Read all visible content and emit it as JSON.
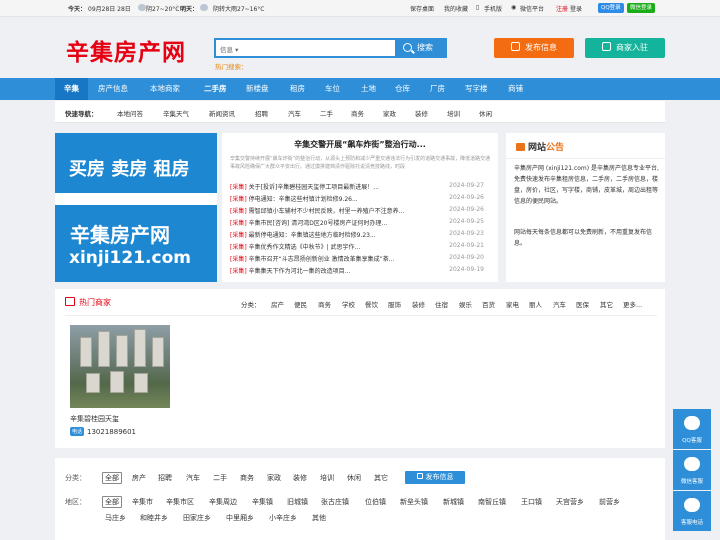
{
  "topbar": {
    "today_label": "今天：",
    "today_text": "09月28日 28日",
    "today_weather": "阴27~20°C",
    "tomorrow_label": "明天：",
    "tomorrow_weather": "阴转大雨27~16°C",
    "links": [
      "保存桌面",
      "我的收藏",
      "手机版",
      "微信平台"
    ],
    "register": "注册",
    "sep": "|",
    "login": "登录",
    "qq_login": "QQ登录",
    "wechat_login": "微信登录",
    "qq_color": "#2d8ce6",
    "wechat_color": "#1aad19"
  },
  "header": {
    "logo": "辛集房产网",
    "search_select": "信息",
    "search_button": "搜索",
    "hot_search": "热门搜索：",
    "publish_button": "发布信息",
    "join_button": "商家入驻",
    "publish_color": "#f46c12",
    "join_color": "#14b39b"
  },
  "nav": {
    "items": [
      "辛集",
      "房产信息",
      "本地商家",
      "二手房",
      "新楼盘",
      "租房",
      "车位",
      "土地",
      "仓库",
      "厂房",
      "写字楼",
      "商铺"
    ]
  },
  "quicknav": {
    "label": "快速导航：",
    "items": [
      "本地问答",
      "辛集天气",
      "新闻资讯",
      "招聘",
      "汽车",
      "二手",
      "商务",
      "家政",
      "装修",
      "培训",
      "休闲"
    ]
  },
  "banner": {
    "line1": "买房 卖房 租房",
    "line2": "辛集房产网",
    "line3": "xinji121.com"
  },
  "news": {
    "headline": "辛集交警开展“飙车炸街”整治行动...",
    "summary": "辛集交警持续开展“飙车炸街”的整治行动，从源头上预防和减少严重交通违法行为引发的道路交通事故，降低道路交通事故风险确保广大群众平安出行。通过摸排建档清作驱除托说清竞技路线，时段",
    "items": [
      {
        "tag": "[采集]",
        "title": "关于[投诉]辛集碧桂园天玺停工项目最新进展！...",
        "date": "2024-09-27"
      },
      {
        "tag": "[采集]",
        "title": "停电通知：辛集这些村镇计划检修9.26...",
        "date": "2024-09-26"
      },
      {
        "tag": "[采集]",
        "title": "需智邱镇小车辅村不少村民反映，村里一养殖户不注意养...",
        "date": "2024-09-26"
      },
      {
        "tag": "[采集]",
        "title": "辛集市民[咨询] 清河湾D区20号楼房产证何时办理...",
        "date": "2024-09-25"
      },
      {
        "tag": "[采集]",
        "title": "最新停电通知：辛集镇这些地方临时检修9.23...",
        "date": "2024-09-23"
      },
      {
        "tag": "[采集]",
        "title": "辛集优秀作文精选《中秋节》| 武思宇作...",
        "date": "2024-09-21"
      },
      {
        "tag": "[采集]",
        "title": "辛集市召开“斗志昂扬创新创业 激情改革集享集成”茶...",
        "date": "2024-09-20"
      },
      {
        "tag": "[采集]",
        "title": "辛集集天下作为河北一集的改造项目...",
        "date": "2024-09-19"
      }
    ]
  },
  "notice": {
    "title_a": "网站",
    "title_b": "公告",
    "p1": "辛集房产网 (xinji121.com) 是辛集房产信息专业平台,免费快速发布辛集租房信息，二手房，二手房信息，楼盘，房价，社区，写字楼，商铺，皮革城，周边出租等信息的便民网站。",
    "p2": "网站每天每条信息都可以免费刷新，不用重复发布信息。"
  },
  "shops": {
    "title": "热门商家",
    "cats_label": "分类：",
    "cats": [
      "房产",
      "便民",
      "商务",
      "学校",
      "餐饮",
      "服饰",
      "装修",
      "住宿",
      "娱乐",
      "百货",
      "家电",
      "丽人",
      "汽车",
      "医保",
      "其它",
      "更多..."
    ],
    "item": {
      "name": "辛集碧桂园天玺",
      "phone_badge": "电话",
      "phone": "13021889601"
    }
  },
  "filter": {
    "category_label": "分类：",
    "categories": [
      "全部",
      "房产",
      "招聘",
      "汽车",
      "二手",
      "商务",
      "家政",
      "装修",
      "培训",
      "休闲",
      "其它"
    ],
    "publish": "发布信息",
    "area_label": "地区：",
    "areas_row1": [
      "全部",
      "辛集市",
      "辛集市区",
      "辛集周边",
      "辛集镇",
      "旧城镇",
      "张古庄镇",
      "位伯镇",
      "新垒头镇",
      "新城镇",
      "南智丘镇",
      "王口镇",
      "天宫营乡",
      "前营乡"
    ],
    "areas_row2": [
      "马庄乡",
      "和睦井乡",
      "田家庄乡",
      "中里厢乡",
      "小辛庄乡",
      "其他"
    ]
  },
  "float": {
    "items": [
      "QQ客服",
      "微信客服",
      "客服电话"
    ]
  }
}
